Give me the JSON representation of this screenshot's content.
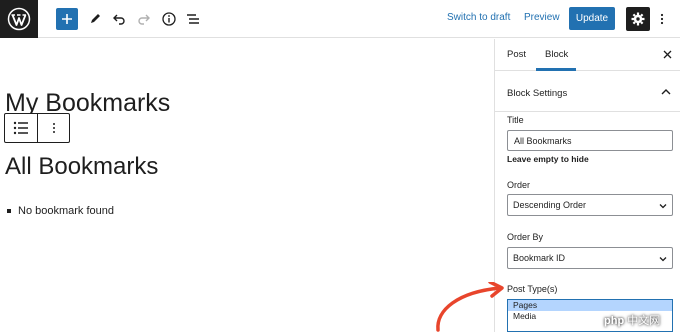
{
  "toolbar": {
    "switch_to_draft": "Switch to draft",
    "preview": "Preview",
    "update": "Update",
    "icons": [
      "wordpress-logo-icon",
      "plus-icon",
      "pencil-icon",
      "undo-icon",
      "redo-icon",
      "info-icon",
      "list-view-icon",
      "gear-icon",
      "more-vertical-icon"
    ]
  },
  "editor": {
    "post_title": "My Bookmarks",
    "block_heading": "All Bookmarks",
    "list_items": [
      "No bookmark found"
    ]
  },
  "sidebar": {
    "tabs": [
      "Post",
      "Block"
    ],
    "active_tab": "Block",
    "panel_title": "Block Settings",
    "title_label": "Title",
    "title_value": "All Bookmarks",
    "title_help": "Leave empty to hide",
    "order_label": "Order",
    "order_value": "Descending Order",
    "order_by_label": "Order By",
    "order_by_value": "Bookmark ID",
    "post_types_label": "Post Type(s)",
    "post_types_options": [
      "Pages",
      "Media"
    ],
    "post_types_selected": "Pages"
  },
  "watermark": {
    "brand": "php",
    "site": "中文网"
  },
  "colors": {
    "accent": "#2271b1",
    "dark": "#1e1e1e",
    "arrow": "#e8452c",
    "selected_option": "#b4d5fe"
  }
}
